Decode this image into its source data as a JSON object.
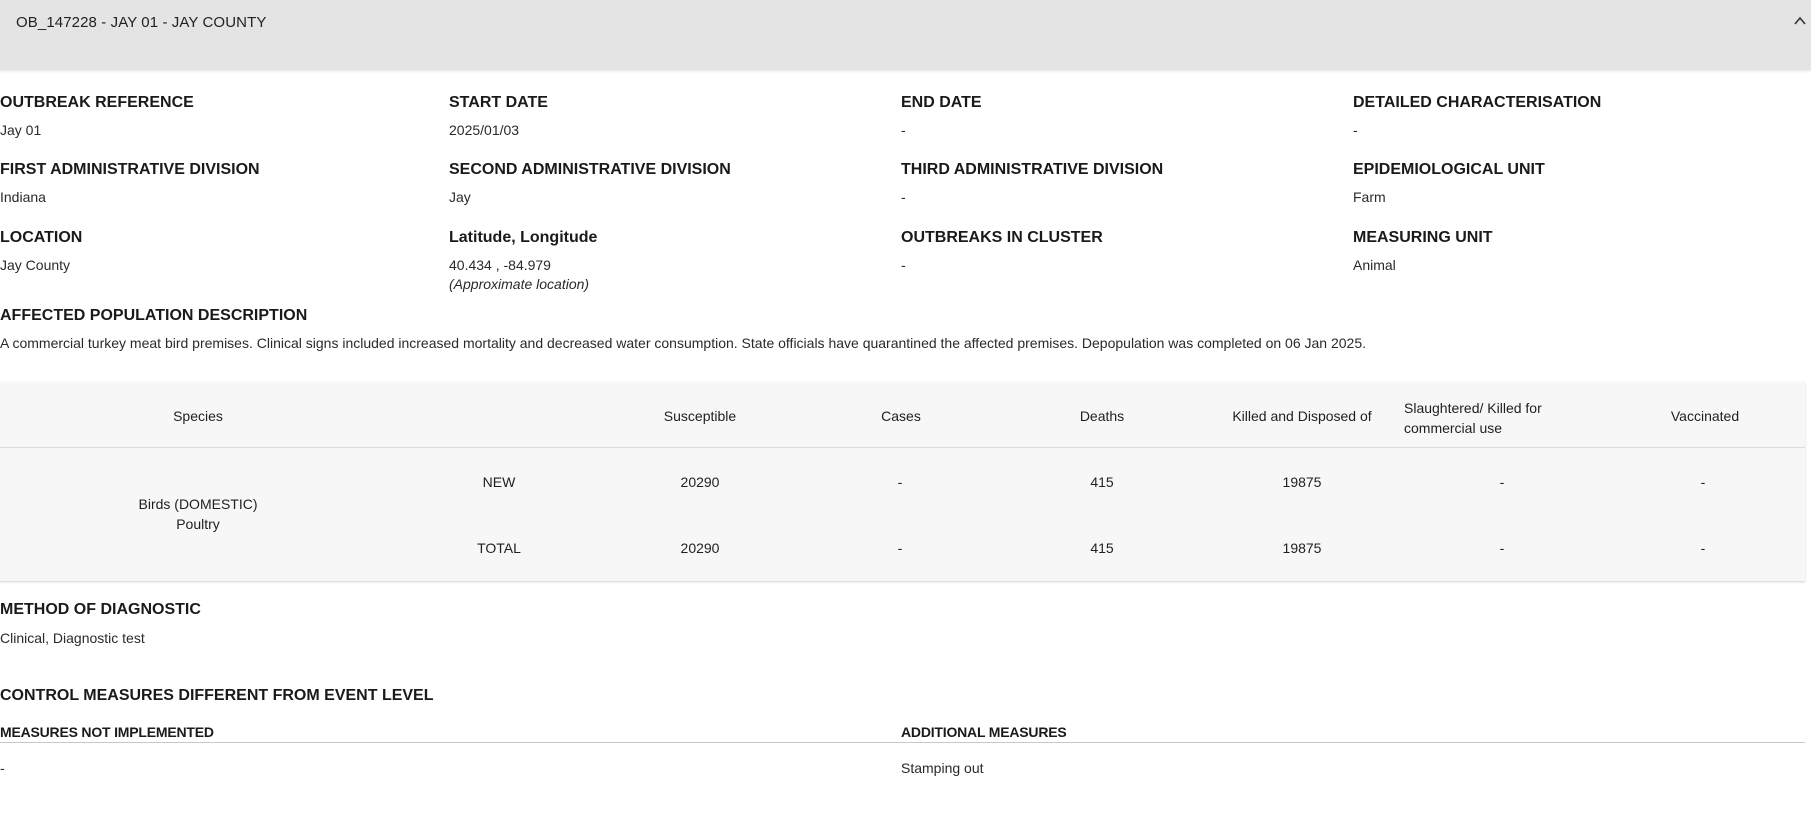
{
  "header": {
    "title": "OB_147228 - JAY 01 - JAY COUNTY",
    "collapse_icon": "chevron-up-icon"
  },
  "info": {
    "outbreak_reference": {
      "label": "OUTBREAK REFERENCE",
      "value": "Jay 01"
    },
    "start_date": {
      "label": "START DATE",
      "value": "2025/01/03"
    },
    "end_date": {
      "label": "END DATE",
      "value": "-"
    },
    "detailed_characterisation": {
      "label": "DETAILED CHARACTERISATION",
      "value": "-"
    },
    "first_admin_division": {
      "label": "FIRST ADMINISTRATIVE DIVISION",
      "value": "Indiana"
    },
    "second_admin_division": {
      "label": "SECOND ADMINISTRATIVE DIVISION",
      "value": "Jay"
    },
    "third_admin_division": {
      "label": "THIRD ADMINISTRATIVE DIVISION",
      "value": "-"
    },
    "epidemiological_unit": {
      "label": "EPIDEMIOLOGICAL UNIT",
      "value": "Farm"
    },
    "location": {
      "label": "LOCATION",
      "value": "Jay County"
    },
    "lat_long": {
      "label": "Latitude, Longitude",
      "value": "40.434 , -84.979",
      "note": "(Approximate location)"
    },
    "outbreaks_in_cluster": {
      "label": "OUTBREAKS IN CLUSTER",
      "value": "-"
    },
    "measuring_unit": {
      "label": "MEASURING UNIT",
      "value": "Animal"
    }
  },
  "affected_population": {
    "label": "AFFECTED POPULATION DESCRIPTION",
    "text": "A commercial turkey meat bird premises. Clinical signs included increased mortality and decreased water consumption. State officials have quarantined the affected premises. Depopulation was completed on 06 Jan 2025."
  },
  "table": {
    "headers": {
      "species": "Species",
      "susceptible": "Susceptible",
      "cases": "Cases",
      "deaths": "Deaths",
      "killed_disposed": "Killed and Disposed of",
      "slaughtered": "Slaughtered/ Killed for commercial use",
      "vaccinated": "Vaccinated"
    },
    "species_name": "Birds (DOMESTIC)",
    "species_type": "Poultry",
    "rows": [
      {
        "label": "NEW",
        "susceptible": "20290",
        "cases": "-",
        "deaths": "415",
        "killed_disposed": "19875",
        "slaughtered": "-",
        "vaccinated": "-"
      },
      {
        "label": "TOTAL",
        "susceptible": "20290",
        "cases": "-",
        "deaths": "415",
        "killed_disposed": "19875",
        "slaughtered": "-",
        "vaccinated": "-"
      }
    ]
  },
  "diagnostic": {
    "label": "METHOD OF DIAGNOSTIC",
    "value": "Clinical, Diagnostic test"
  },
  "control_measures": {
    "label": "CONTROL MEASURES DIFFERENT FROM EVENT LEVEL",
    "not_implemented_label": "MEASURES NOT IMPLEMENTED",
    "not_implemented_value": "-",
    "additional_label": "ADDITIONAL MEASURES",
    "additional_value": "Stamping out"
  }
}
